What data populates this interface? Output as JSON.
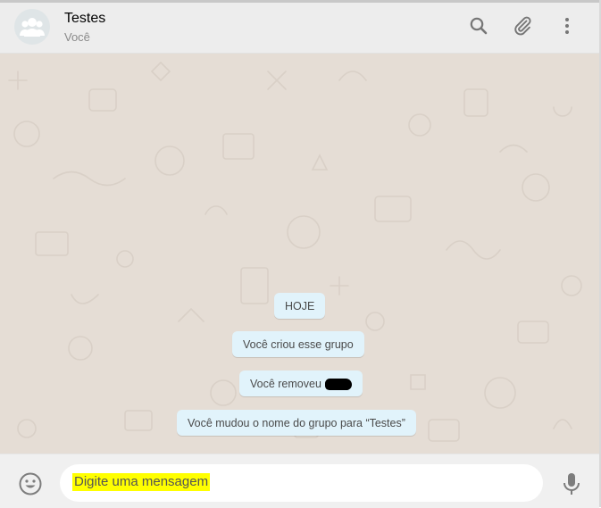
{
  "header": {
    "title": "Testes",
    "subtitle": "Você",
    "icons": [
      "group-avatar-icon",
      "search-icon",
      "attach-icon",
      "menu-icon"
    ]
  },
  "chat": {
    "date_label": "HOJE",
    "messages": [
      {
        "text": "Você criou esse grupo"
      },
      {
        "text": "Você removeu",
        "redacted": true
      },
      {
        "text": "Você mudou o nome do grupo para “Testes”"
      }
    ]
  },
  "composer": {
    "placeholder": "Digite uma mensagem",
    "icons": [
      "emoji-icon",
      "mic-icon"
    ]
  },
  "colors": {
    "header_bg": "#ededed",
    "chat_bg": "#e5ddd5",
    "system_bubble": "#e1f3fb",
    "footer_bg": "#f0f0f0",
    "highlight": "#ffff00"
  }
}
